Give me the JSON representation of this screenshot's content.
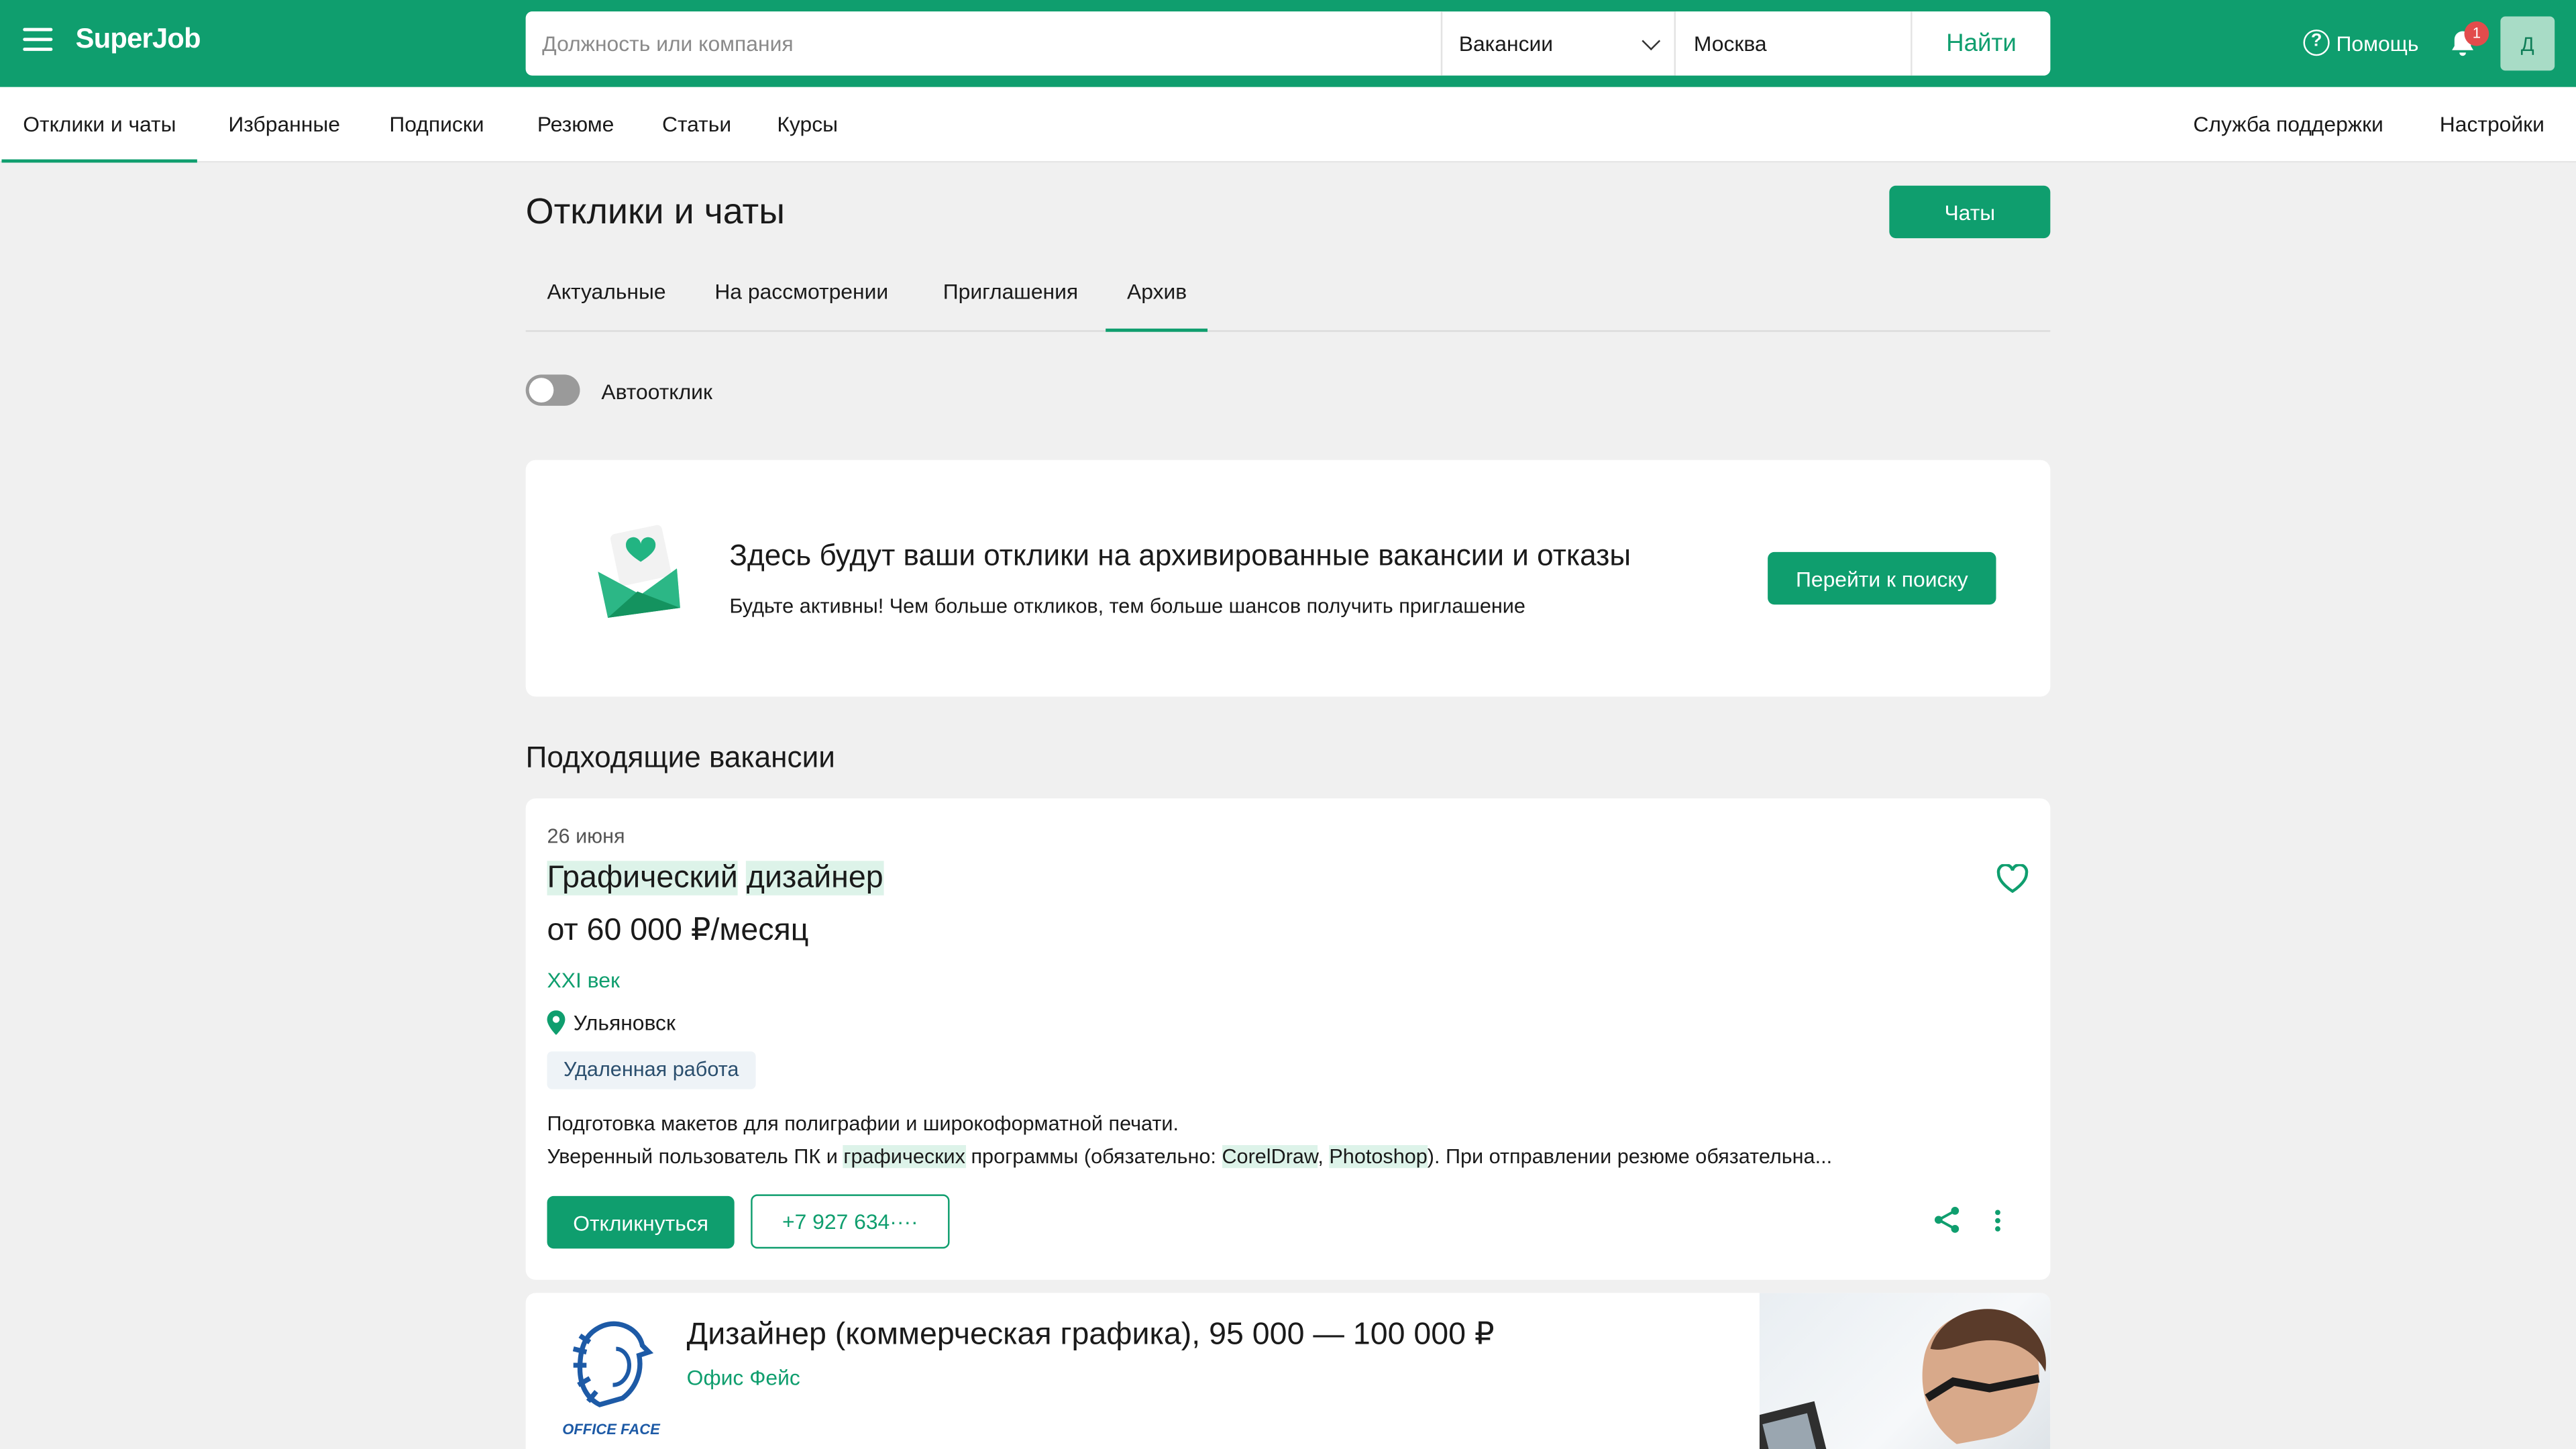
{
  "header": {
    "logo_text": "SuperJob",
    "search_placeholder": "Должность или компания",
    "search_type": "Вакансии",
    "city": "Москва",
    "find_label": "Найти",
    "help_label": "Помощь",
    "notification_count": "1",
    "avatar_letter": "Д"
  },
  "subnav": {
    "items": [
      "Отклики и чаты",
      "Избранные",
      "Подписки",
      "Резюме",
      "Статьи",
      "Курсы"
    ],
    "support": "Служба поддержки",
    "settings": "Настройки"
  },
  "page": {
    "title": "Отклики и чаты",
    "chats_button": "Чаты",
    "tabs": [
      "Актуальные",
      "На рассмотрении",
      "Приглашения",
      "Архив"
    ],
    "active_tab": "Архив",
    "autorespond_label": "Автоотклик",
    "autorespond_on": false
  },
  "empty_state": {
    "title": "Здесь будут ваши отклики на архивированные вакансии и отказы",
    "subtitle": "Будьте активны! Чем больше откликов, тем больше шансов получить приглашение",
    "button": "Перейти к поиску"
  },
  "suggested": {
    "section_title": "Подходящие вакансии",
    "jobs": [
      {
        "date": "26 июня",
        "title_part1": "Графический",
        "title_part2": "дизайнер",
        "salary": "от 60 000 ₽/месяц",
        "company": "XXI век",
        "city": "Ульяновск",
        "tag": "Удаленная работа",
        "desc_line1": "Подготовка макетов для полиграфии и широкоформатной печати.",
        "desc_line2_a": "Уверенный пользователь ПК и ",
        "desc_line2_hl1": "графических",
        "desc_line2_b": " программы (обязательно: ",
        "desc_line2_hl2": "CorelDraw",
        "desc_line2_c": ", ",
        "desc_line2_hl3": "Photoshop",
        "desc_line2_d": "). При отправлении резюме обязательна...",
        "respond_button": "Откликнуться",
        "phone": "+7 927 634····"
      },
      {
        "title": "Дизайнер (коммерческая графика), 95 000 — 100 000 ₽",
        "company": "Офис Фейс",
        "logo_text": "OFFICE FACE"
      }
    ]
  },
  "colors": {
    "brand": "#0f9e6e",
    "badge": "#e24c4c",
    "background": "#f0f0f0"
  }
}
